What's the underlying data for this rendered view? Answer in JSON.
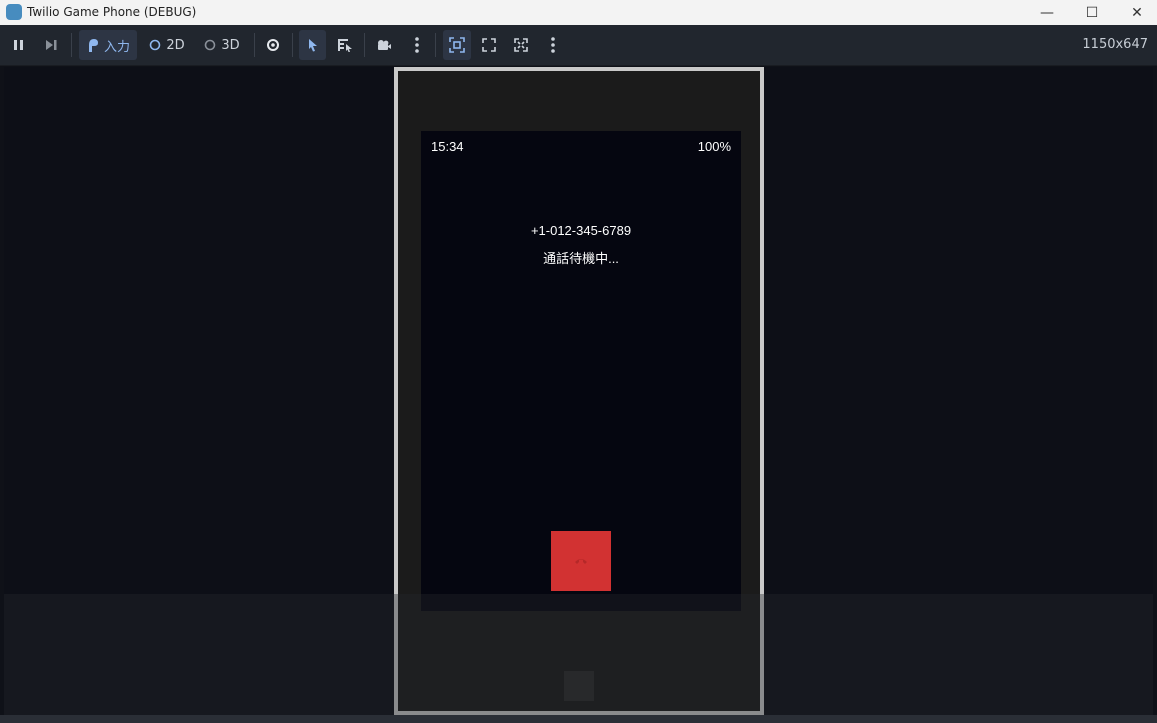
{
  "window": {
    "title": "Twilio Game Phone (DEBUG)",
    "minimize_glyph": "—",
    "maximize_glyph": "☐",
    "close_glyph": "✕"
  },
  "toolbar": {
    "input_label": "入力",
    "mode_2d_label": "2D",
    "mode_3d_label": "3D",
    "resolution": "1150x647"
  },
  "phone": {
    "time": "15:34",
    "battery": "100%",
    "number": "+1-012-345-6789",
    "call_status": "通話待機中..."
  },
  "colors": {
    "accent": "#478cbf",
    "end_call": "#d23232",
    "screen_bg": "#050610"
  }
}
